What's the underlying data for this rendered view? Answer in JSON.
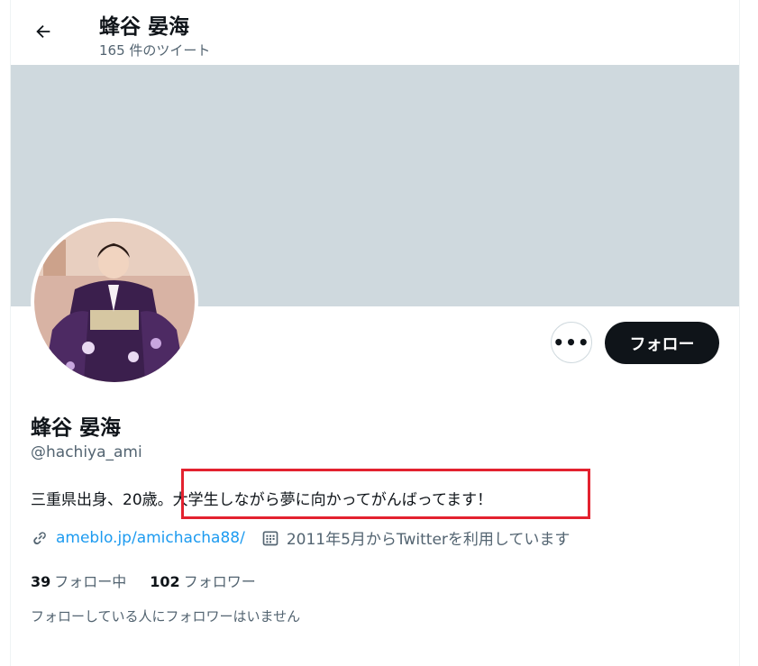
{
  "header": {
    "back_icon": "arrow-left-icon",
    "name": "蜂谷 晏海",
    "tweet_count": "165 件のツイート"
  },
  "profile": {
    "display_name": "蜂谷 晏海",
    "handle": "@hachiya_ami",
    "bio_prefix": "三重県出身、20歳。",
    "bio_highlight": "大学生しながら夢に向かってがんばってます！",
    "url": "ameblo.jp/amichacha88/",
    "joined": "2011年5月からTwitterを利用しています",
    "following_count": "39",
    "following_label": "フォロー中",
    "followers_count": "102",
    "followers_label": "フォロワー",
    "no_common_followers": "フォローしている人にフォロワーはいません"
  },
  "actions": {
    "more_label": "•••",
    "follow_label": "フォロー"
  },
  "colors": {
    "banner": "#cfd9de",
    "link": "#1d9bf0",
    "follow_button": "#0f1419",
    "highlight_border": "#e3222f"
  }
}
